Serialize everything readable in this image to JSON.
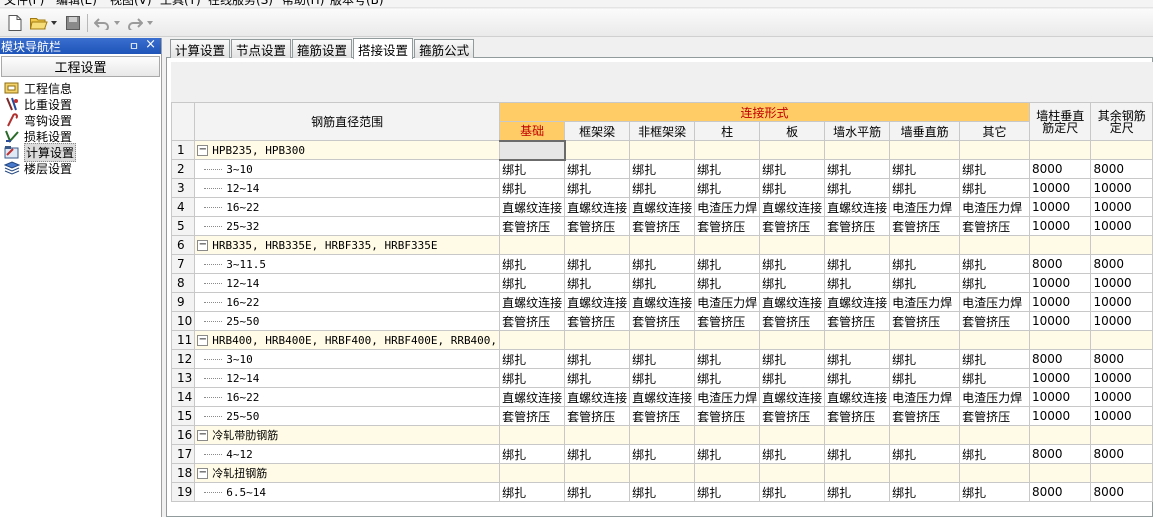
{
  "menu": [
    "文件(F)",
    "编辑(E)",
    "视图(V)",
    "工具(T)",
    "在线服务(S)",
    "帮助(H)",
    "版本号(B)"
  ],
  "toolbar": {
    "icons": [
      "new-file-icon",
      "open-folder-icon",
      "dropdown-arrow-icon",
      "save-icon",
      "undo-icon",
      "undo-dropdown-icon",
      "redo-icon",
      "redo-dropdown-icon"
    ]
  },
  "nav": {
    "title": "模块导航栏",
    "pin_glyph": "ㅁ",
    "close_glyph": "×",
    "section": "工程设置",
    "items": [
      {
        "label": "工程信息",
        "icon": "project-info-icon"
      },
      {
        "label": "比重设置",
        "icon": "ratio-icon"
      },
      {
        "label": "弯钩设置",
        "icon": "hook-icon"
      },
      {
        "label": "损耗设置",
        "icon": "loss-icon"
      },
      {
        "label": "计算设置",
        "icon": "calc-settings-icon",
        "selected": true
      },
      {
        "label": "楼层设置",
        "icon": "floor-icon"
      }
    ]
  },
  "tabs": [
    {
      "label": "计算设置"
    },
    {
      "label": "节点设置"
    },
    {
      "label": "箍筋设置"
    },
    {
      "label": "搭接设置",
      "active": true
    },
    {
      "label": "箍筋公式"
    }
  ],
  "table": {
    "header_range": "钢筋直径范围",
    "header_connection": "连接形式",
    "connection_columns": [
      "基础",
      "框架梁",
      "非框架梁",
      "柱",
      "板",
      "墙水平筋",
      "墙垂直筋",
      "其它"
    ],
    "header_wall_column_fixed": "墙柱垂直筋定尺",
    "header_other_fixed": "其余钢筋定尺",
    "colors": {
      "header_highlight": "#ffcc66",
      "header_text_red": "#c00000",
      "group_row": "#fffbe6"
    },
    "rows": [
      {
        "n": "1",
        "group": true,
        "label": "HPB235, HPB300"
      },
      {
        "n": "2",
        "label": "3~10",
        "cells": [
          "绑扎",
          "绑扎",
          "绑扎",
          "绑扎",
          "绑扎",
          "绑扎",
          "绑扎",
          "绑扎"
        ],
        "fix1": "8000",
        "fix2": "8000"
      },
      {
        "n": "3",
        "label": "12~14",
        "cells": [
          "绑扎",
          "绑扎",
          "绑扎",
          "绑扎",
          "绑扎",
          "绑扎",
          "绑扎",
          "绑扎"
        ],
        "fix1": "10000",
        "fix2": "10000"
      },
      {
        "n": "4",
        "label": "16~22",
        "cells": [
          "直螺纹连接",
          "直螺纹连接",
          "直螺纹连接",
          "电渣压力焊",
          "直螺纹连接",
          "直螺纹连接",
          "电渣压力焊",
          "电渣压力焊"
        ],
        "fix1": "10000",
        "fix2": "10000"
      },
      {
        "n": "5",
        "label": "25~32",
        "cells": [
          "套管挤压",
          "套管挤压",
          "套管挤压",
          "套管挤压",
          "套管挤压",
          "套管挤压",
          "套管挤压",
          "套管挤压"
        ],
        "fix1": "10000",
        "fix2": "10000"
      },
      {
        "n": "6",
        "group": true,
        "label": "HRB335, HRB335E, HRBF335, HRBF335E"
      },
      {
        "n": "7",
        "label": "3~11.5",
        "cells": [
          "绑扎",
          "绑扎",
          "绑扎",
          "绑扎",
          "绑扎",
          "绑扎",
          "绑扎",
          "绑扎"
        ],
        "fix1": "8000",
        "fix2": "8000"
      },
      {
        "n": "8",
        "label": "12~14",
        "cells": [
          "绑扎",
          "绑扎",
          "绑扎",
          "绑扎",
          "绑扎",
          "绑扎",
          "绑扎",
          "绑扎"
        ],
        "fix1": "10000",
        "fix2": "10000"
      },
      {
        "n": "9",
        "label": "16~22",
        "cells": [
          "直螺纹连接",
          "直螺纹连接",
          "直螺纹连接",
          "电渣压力焊",
          "直螺纹连接",
          "直螺纹连接",
          "电渣压力焊",
          "电渣压力焊"
        ],
        "fix1": "10000",
        "fix2": "10000"
      },
      {
        "n": "10",
        "label": "25~50",
        "cells": [
          "套管挤压",
          "套管挤压",
          "套管挤压",
          "套管挤压",
          "套管挤压",
          "套管挤压",
          "套管挤压",
          "套管挤压"
        ],
        "fix1": "10000",
        "fix2": "10000"
      },
      {
        "n": "11",
        "group": true,
        "label": "HRB400, HRB400E, HRBF400, HRBF400E, RRB400,"
      },
      {
        "n": "12",
        "label": "3~10",
        "cells": [
          "绑扎",
          "绑扎",
          "绑扎",
          "绑扎",
          "绑扎",
          "绑扎",
          "绑扎",
          "绑扎"
        ],
        "fix1": "8000",
        "fix2": "8000"
      },
      {
        "n": "13",
        "label": "12~14",
        "cells": [
          "绑扎",
          "绑扎",
          "绑扎",
          "绑扎",
          "绑扎",
          "绑扎",
          "绑扎",
          "绑扎"
        ],
        "fix1": "10000",
        "fix2": "10000"
      },
      {
        "n": "14",
        "label": "16~22",
        "cells": [
          "直螺纹连接",
          "直螺纹连接",
          "直螺纹连接",
          "电渣压力焊",
          "直螺纹连接",
          "直螺纹连接",
          "电渣压力焊",
          "电渣压力焊"
        ],
        "fix1": "10000",
        "fix2": "10000"
      },
      {
        "n": "15",
        "label": "25~50",
        "cells": [
          "套管挤压",
          "套管挤压",
          "套管挤压",
          "套管挤压",
          "套管挤压",
          "套管挤压",
          "套管挤压",
          "套管挤压"
        ],
        "fix1": "10000",
        "fix2": "10000"
      },
      {
        "n": "16",
        "group": true,
        "label": "冷轧带肋钢筋"
      },
      {
        "n": "17",
        "label": "4~12",
        "cells": [
          "绑扎",
          "绑扎",
          "绑扎",
          "绑扎",
          "绑扎",
          "绑扎",
          "绑扎",
          "绑扎"
        ],
        "fix1": "8000",
        "fix2": "8000"
      },
      {
        "n": "18",
        "group": true,
        "label": "冷轧扭钢筋"
      },
      {
        "n": "19",
        "label": "6.5~14",
        "cells": [
          "绑扎",
          "绑扎",
          "绑扎",
          "绑扎",
          "绑扎",
          "绑扎",
          "绑扎",
          "绑扎"
        ],
        "fix1": "8000",
        "fix2": "8000"
      }
    ]
  }
}
